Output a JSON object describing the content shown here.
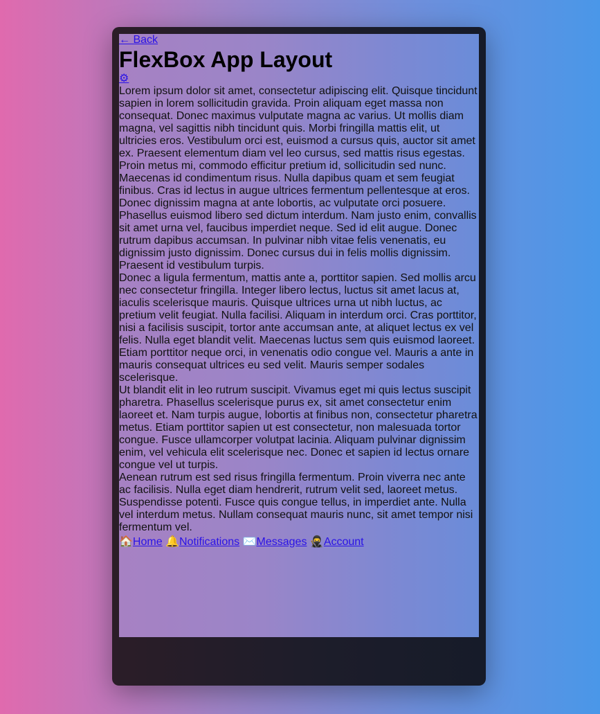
{
  "header": {
    "back_label": "← Back",
    "title": "FlexBox App Layout",
    "settings_icon": "⚙"
  },
  "content": {
    "paragraphs": [
      "Lorem ipsum dolor sit amet, consectetur adipiscing elit. Quisque tincidunt sapien in lorem sollicitudin gravida. Proin aliquam eget massa non consequat. Donec maximus vulputate magna ac varius. Ut mollis diam magna, vel sagittis nibh tincidunt quis. Morbi fringilla mattis elit, ut ultricies eros. Vestibulum orci est, euismod a cursus quis, auctor sit amet ex. Praesent elementum diam vel leo cursus, sed mattis risus egestas. Proin metus mi, commodo efficitur pretium id, sollicitudin sed nunc. Maecenas id condimentum risus. Nulla dapibus quam et sem feugiat finibus. Cras id lectus in augue ultrices fermentum pellentesque at eros. Donec dignissim magna at ante lobortis, ac vulputate orci posuere. Phasellus euismod libero sed dictum interdum. Nam justo enim, convallis sit amet urna vel, faucibus imperdiet neque. Sed id elit augue. Donec rutrum dapibus accumsan. In pulvinar nibh vitae felis venenatis, eu dignissim justo dignissim. Donec cursus dui in felis mollis dignissim. Praesent id vestibulum turpis.",
      "Donec a ligula fermentum, mattis ante a, porttitor sapien. Sed mollis arcu nec consectetur fringilla. Integer libero lectus, luctus sit amet lacus at, iaculis scelerisque mauris. Quisque ultrices urna ut nibh luctus, ac pretium velit feugiat. Nulla facilisi. Aliquam in interdum orci. Cras porttitor, nisi a facilisis suscipit, tortor ante accumsan ante, at aliquet lectus ex vel felis. Nulla eget blandit velit. Maecenas luctus sem quis euismod laoreet. Etiam porttitor neque orci, in venenatis odio congue vel. Mauris a ante in mauris consequat ultrices eu sed velit. Mauris semper sodales scelerisque.",
      "Ut blandit elit in leo rutrum suscipit. Vivamus eget mi quis lectus suscipit pharetra. Phasellus scelerisque purus ex, sit amet consectetur enim laoreet et. Nam turpis augue, lobortis at finibus non, consectetur pharetra metus. Etiam porttitor sapien ut est consectetur, non malesuada tortor congue. Fusce ullamcorper volutpat lacinia. Aliquam pulvinar dignissim enim, vel vehicula elit scelerisque nec. Donec et sapien id lectus ornare congue vel ut turpis.",
      "Aenean rutrum est sed risus fringilla fermentum. Proin viverra nec ante ac facilisis. Nulla eget diam hendrerit, rutrum velit sed, laoreet metus. Suspendisse potenti. Fusce quis congue tellus, in imperdiet ante. Nulla vel interdum metus. Nullam consequat mauris nunc, sit amet tempor nisi fermentum vel."
    ]
  },
  "nav": {
    "items": [
      {
        "icon": "🏠",
        "icon_name": "home-icon",
        "label": "Home"
      },
      {
        "icon": "🔔",
        "icon_name": "bell-icon",
        "label": "Notifications"
      },
      {
        "icon": "✉️",
        "icon_name": "envelope-icon",
        "label": "Messages"
      },
      {
        "icon": "🥷",
        "icon_name": "account-icon",
        "label": "Account"
      }
    ]
  },
  "colors": {
    "link": "#2a12e6",
    "frame": "#1d1d2a"
  }
}
